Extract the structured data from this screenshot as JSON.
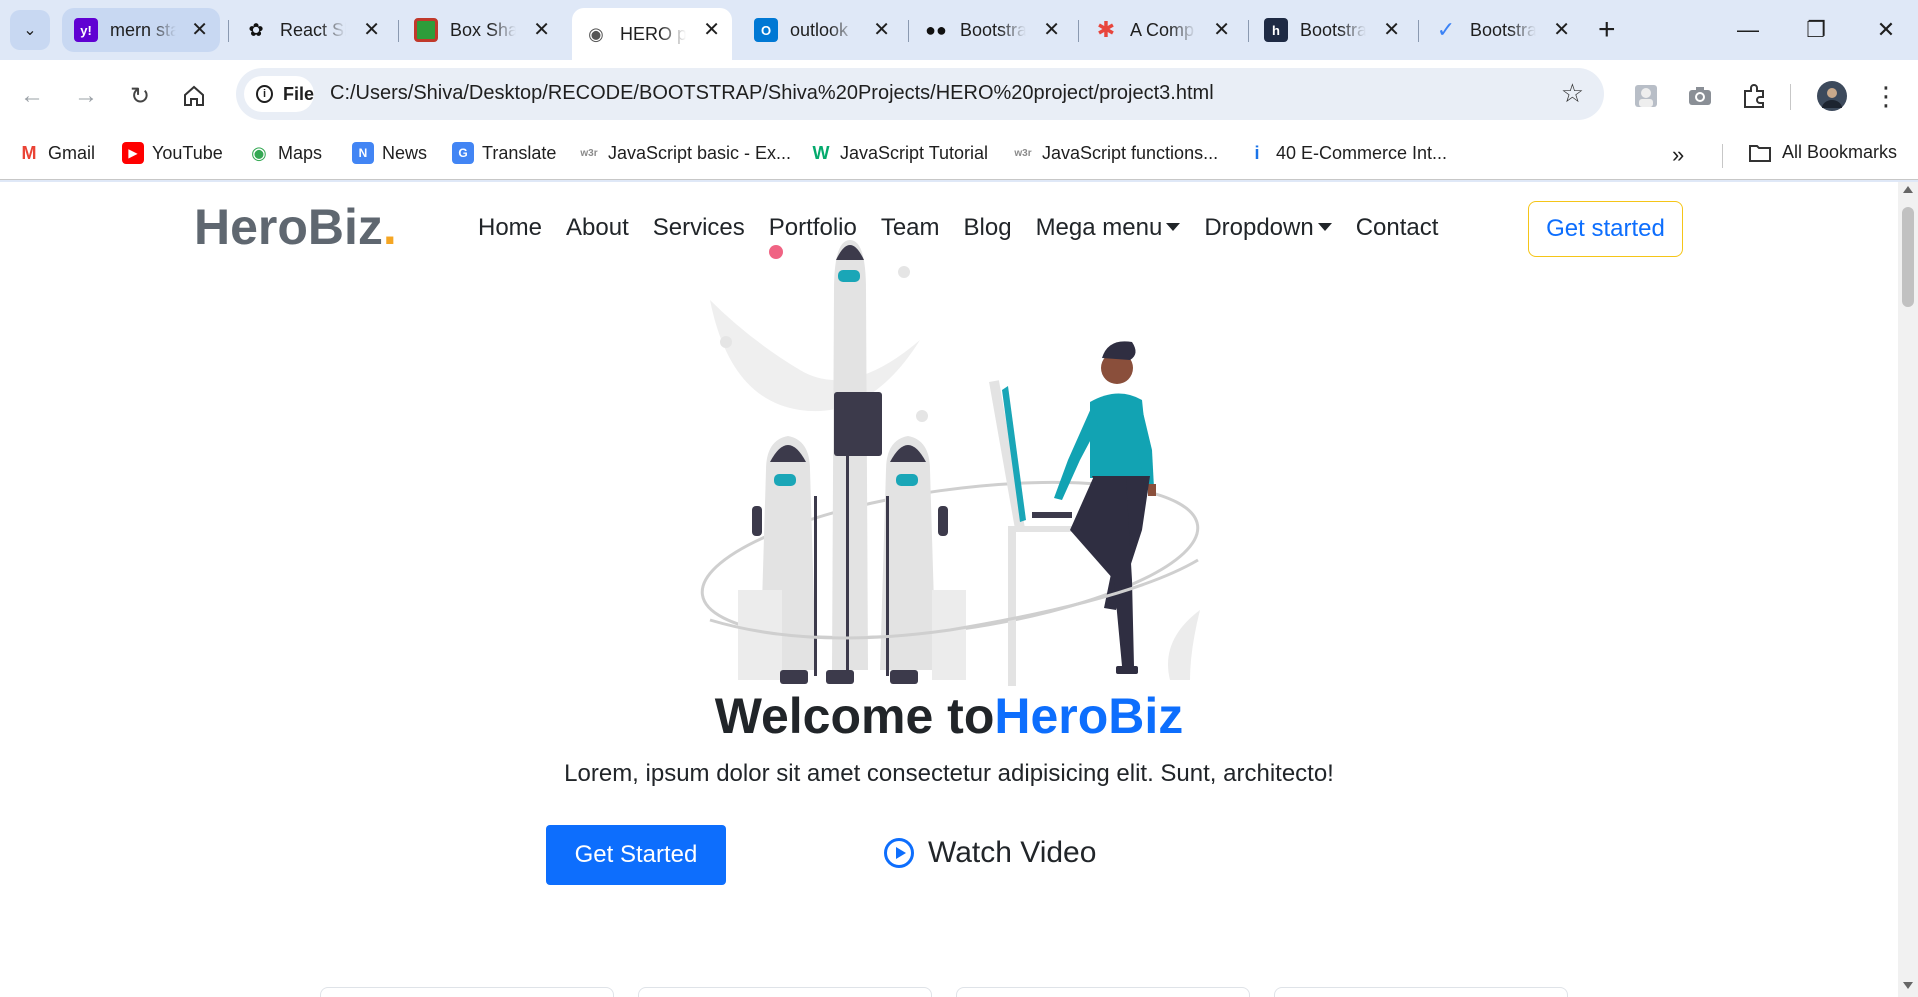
{
  "browser": {
    "tabs": [
      {
        "label": "mern sta",
        "favicon": "yahoo-icon",
        "color": "#6001d2",
        "state": "first"
      },
      {
        "label": "React Sk",
        "favicon": "openai-icon",
        "color": "#111111",
        "state": "normal"
      },
      {
        "label": "Box Sha",
        "favicon": "box-shadow-icon",
        "color": "#2e9d3a",
        "state": "normal"
      },
      {
        "label": "HERO p",
        "favicon": "globe-icon",
        "color": "#555555",
        "state": "active"
      },
      {
        "label": "outlook",
        "favicon": "outlook-icon",
        "color": "#0078d4",
        "state": "normal"
      },
      {
        "label": "Bootstra",
        "favicon": "bootstrap-mask-icon",
        "color": "#111111",
        "state": "normal"
      },
      {
        "label": "A Comp",
        "favicon": "asterisk-icon",
        "color": "#e8453c",
        "state": "normal"
      },
      {
        "label": "Bootstra",
        "favicon": "h-icon",
        "color": "#1e2a44",
        "state": "normal"
      },
      {
        "label": "Bootstra",
        "favicon": "check-icon",
        "color": "#3b82f6",
        "state": "normal"
      }
    ],
    "omnibox": {
      "scheme_label": "File",
      "url": "C:/Users/Shiva/Desktop/RECODE/BOOTSTRAP/Shiva%20Projects/HERO%20project/project3.html"
    },
    "bookmarks": [
      {
        "label": "Gmail",
        "icon": "gmail-icon",
        "color": "#ea4335"
      },
      {
        "label": "YouTube",
        "icon": "youtube-icon",
        "color": "#ff0000"
      },
      {
        "label": "Maps",
        "icon": "maps-icon",
        "color": "#34a853"
      },
      {
        "label": "News",
        "icon": "news-icon",
        "color": "#4285f4"
      },
      {
        "label": "Translate",
        "icon": "translate-icon",
        "color": "#4285f4"
      },
      {
        "label": "JavaScript basic - Ex...",
        "icon": "w3r-icon",
        "color": "#8a8a8a"
      },
      {
        "label": "JavaScript Tutorial",
        "icon": "w3schools-icon",
        "color": "#04aa6d"
      },
      {
        "label": "JavaScript functions...",
        "icon": "w3r-icon",
        "color": "#8a8a8a"
      },
      {
        "label": "40 E-Commerce Int...",
        "icon": "info-pin-icon",
        "color": "#1a73e8"
      }
    ],
    "all_bookmarks_label": "All Bookmarks"
  },
  "site": {
    "brand": "HeroBiz",
    "brand_dot": ".",
    "nav": [
      "Home",
      "About",
      "Services",
      "Portfolio",
      "Team",
      "Blog",
      "Mega menu",
      "Dropdown",
      "Contact"
    ],
    "nav_dropdown_items": [
      "Mega menu",
      "Dropdown"
    ],
    "cta": "Get started",
    "hero": {
      "title_prefix": "Welcome to",
      "title_accent": "HeroBiz",
      "subtitle": "Lorem, ipsum dolor sit amet consectetur adipisicing elit. Sunt, architecto!",
      "primary_button": "Get Started",
      "video_link": "Watch Video"
    },
    "colors": {
      "accent": "#0d6efd",
      "brand_dot": "#f5a623",
      "cta_border": "#f5c518"
    }
  }
}
